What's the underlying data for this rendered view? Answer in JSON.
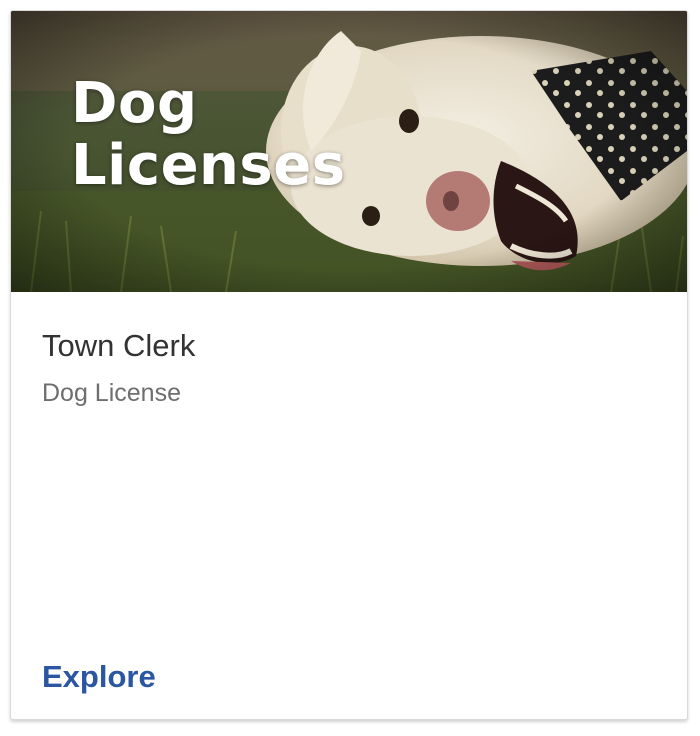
{
  "card": {
    "hero_title": "Dog\nLicenses",
    "hero_image": "dog-photo",
    "department": "Town Clerk",
    "service": "Dog License",
    "action_label": "Explore"
  },
  "colors": {
    "link": "#2a56a2",
    "department_text": "#333333",
    "service_text": "#6e6e6e",
    "hero_title_text": "#ffffff"
  }
}
